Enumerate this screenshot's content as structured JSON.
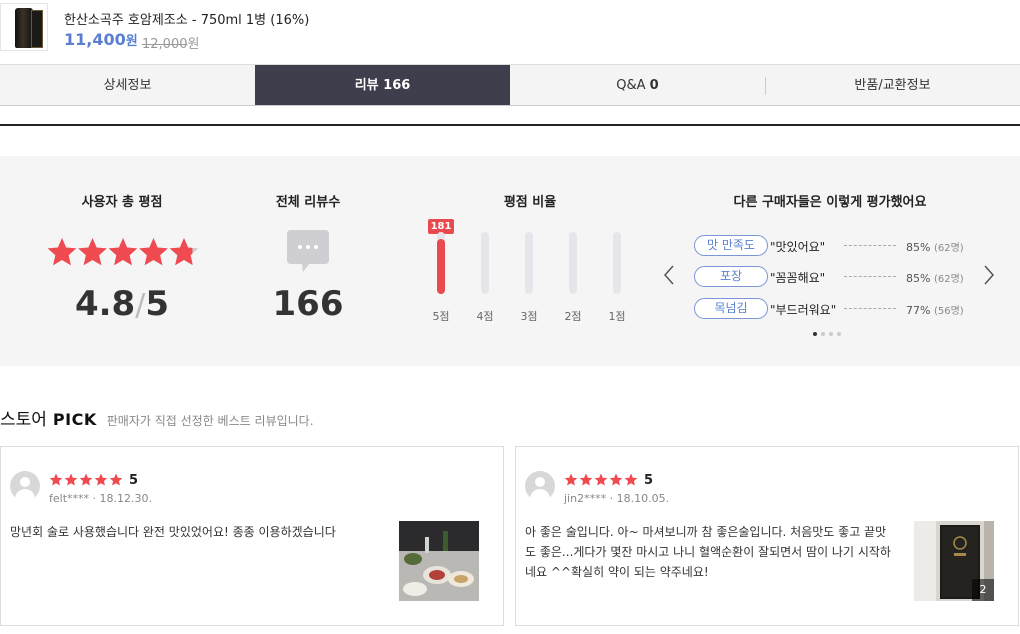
{
  "product": {
    "name": "한산소곡주 호암제조소 - 750ml 1병 (16%)",
    "price": "11,400",
    "price_unit": "원",
    "original_price": "12,000",
    "original_unit": "원"
  },
  "tabs": [
    {
      "label": "상세정보",
      "count": ""
    },
    {
      "label": "리뷰",
      "count": "166"
    },
    {
      "label": "Q&A",
      "count": "0"
    },
    {
      "label": "반품/교환정보",
      "count": ""
    }
  ],
  "summary": {
    "rating_heading": "사용자 총 평점",
    "rating": "4.8",
    "rating_slash": "/",
    "rating_max": "5",
    "rating_stars": 4.8,
    "reviews_heading": "전체 리뷰수",
    "total_reviews": "166",
    "ratio_heading": "평점 비율",
    "bars": [
      {
        "label": "5점",
        "count": "181",
        "ratio": 0.88
      },
      {
        "label": "4점",
        "ratio": 0
      },
      {
        "label": "3점",
        "ratio": 0
      },
      {
        "label": "2점",
        "ratio": 0
      },
      {
        "label": "1점",
        "ratio": 0
      }
    ],
    "keywords_heading": "다른 구매자들은 이렇게 평가했어요",
    "keywords": [
      {
        "tag": "맛 만족도",
        "text": "\"맛있어요\"",
        "percent": "85%",
        "count": "(62명)"
      },
      {
        "tag": "포장",
        "text": "\"꼼꼼해요\"",
        "percent": "85%",
        "count": "(62명)"
      },
      {
        "tag": "목넘김",
        "text": "\"부드러워요\"",
        "percent": "77%",
        "count": "(56명)"
      }
    ],
    "pager_total": 4,
    "pager_active": 0
  },
  "pick": {
    "title": "스토어",
    "title_bold": "PICK",
    "subtitle": "판매자가 직접 선정한 베스트 리뷰입니다."
  },
  "reviews": [
    {
      "score": "5",
      "stars": 5,
      "user": "felt****",
      "date": "18.12.30.",
      "text": "망년회 술로 사용했습니다 완전 맛있었어요! 종종 이용하겠습니다",
      "photo_count": ""
    },
    {
      "score": "5",
      "stars": 5,
      "user": "jin2****",
      "date": "18.10.05.",
      "text": "아 좋은 술입니다. 아~ 마셔보니까 참 좋은술입니다. 처음맛도 좋고 끝맛도 좋은...게다가 몇잔 마시고 나니 혈액순환이 잘되면서 땀이 나기 시작하네요 ^^확실히 약이 되는 약주네요!",
      "photo_count": "2"
    }
  ],
  "colors": {
    "accent": "#e84a4f",
    "brand_blue": "#5a7fd0",
    "tab_active": "#3f3e4c"
  }
}
